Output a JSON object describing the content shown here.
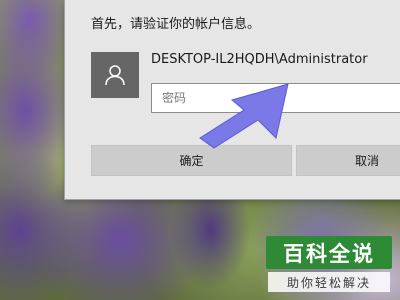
{
  "dialog": {
    "prompt": "首先，请验证你的帐户信息。",
    "account_name": "DESKTOP-IL2HQDH\\Administrator",
    "account_icon": "user-icon",
    "password": {
      "value": "",
      "placeholder": "密码"
    },
    "buttons": {
      "ok_label": "确定",
      "cancel_label": "取消"
    }
  },
  "annotation": {
    "arrow_icon": "arrow-icon",
    "arrow_color": "#7b78e8"
  },
  "watermark": {
    "main": "百科全说",
    "sub": "助你轻松解决",
    "color": "#2f8a36"
  }
}
